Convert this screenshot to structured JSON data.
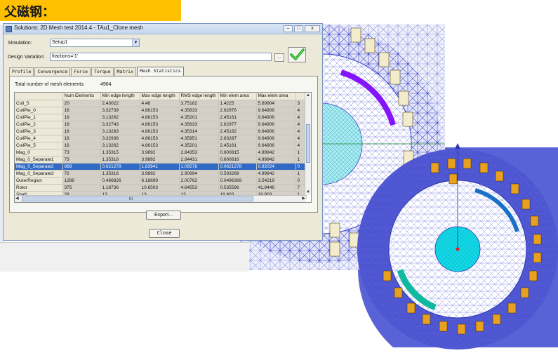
{
  "banner": {
    "text": "父磁钢："
  },
  "window": {
    "title": "Solutions: 2D Mesh test 2014.4 - TAu1_Clone mesh",
    "minimize": "–",
    "maximize": "□",
    "close": "x"
  },
  "simulation": {
    "label": "Simulation:",
    "value": "Setup1"
  },
  "design_variation": {
    "label": "Design Variation:",
    "value": "fractions='1'",
    "browse": "..."
  },
  "tabs": [
    {
      "label": "Profile"
    },
    {
      "label": "Convergence"
    },
    {
      "label": "Force"
    },
    {
      "label": "Torque"
    },
    {
      "label": "Matrix"
    },
    {
      "label": "Mesh Statistics"
    }
  ],
  "total": {
    "label": "Total number of mesh elements:",
    "value": "4964"
  },
  "table": {
    "headers": [
      "",
      "Num Elements",
      "Min edge length",
      "Max edge length",
      "RMS edge length",
      "Min elem area",
      "Max elem area",
      ""
    ],
    "rows": [
      [
        "Coil_5",
        "20",
        "2.43022",
        "4.48",
        "3.75182",
        "1.4225",
        "5.69904",
        "3"
      ],
      [
        "CoilPie_0",
        "16",
        "3.32739",
        "4.86153",
        "4.35833",
        "2.62976",
        "9.64906",
        "4"
      ],
      [
        "CoilPie_1",
        "16",
        "3.13262",
        "4.86153",
        "4.35201",
        "2.45161",
        "9.64906",
        "4"
      ],
      [
        "CoilPie_2",
        "16",
        "3.32743",
        "4.86153",
        "4.35833",
        "2.62977",
        "9.64906",
        "4"
      ],
      [
        "CoilPie_3",
        "16",
        "3.13263",
        "4.86153",
        "4.35314",
        "2.45162",
        "9.64906",
        "4"
      ],
      [
        "CoilPie_4",
        "16",
        "3.32936",
        "4.86153",
        "4.35951",
        "2.63287",
        "9.64906",
        "4"
      ],
      [
        "CoilPie_5",
        "16",
        "3.13262",
        "4.86153",
        "4.35201",
        "2.45161",
        "9.64906",
        "4"
      ],
      [
        "Mag_0",
        "73",
        "1.35315",
        "3.9892",
        "2.84353",
        "0.600815",
        "4.99942",
        "1"
      ],
      [
        "Mag_0_Separate1",
        "73",
        "1.35318",
        "3.9892",
        "2.84431",
        "0.600816",
        "4.99942",
        "1"
      ],
      [
        "Mag_0_Separate2",
        "869",
        "0.621278",
        "1.83941",
        "1.09578",
        "0.0621278",
        "0.92024",
        "0"
      ],
      [
        "Mag_0_Separate3",
        "72",
        "1.35316",
        "3.9892",
        "2.90994",
        "0.593268",
        "4.99942",
        "1"
      ],
      [
        "OuterRegion",
        "1288",
        "0.466826",
        "6.18699",
        "2.00762",
        "0.0496369",
        "3.54219",
        "0"
      ],
      [
        "Rotor",
        "375",
        "1.18736",
        "10.6503",
        "4.64553",
        "0.535596",
        "41.8446",
        "7"
      ],
      [
        "Shaft",
        "28",
        "13",
        "13",
        "13",
        "18.803",
        "18.803",
        "1"
      ]
    ],
    "selected_row": 9,
    "hscroll_mark": "III"
  },
  "buttons": {
    "export": "Export...",
    "close": "Close"
  },
  "colors": {
    "banner": "#ffc000",
    "mesh_blue": "#3a44c8",
    "mesh_light": "#dcdcf4",
    "rotor_cyan": "#10d8e6",
    "magnet_purple": "#8a10ff",
    "magnet_teal": "#10b8a0",
    "coil_orange": "#e8a020",
    "selection": "#316ac5"
  }
}
